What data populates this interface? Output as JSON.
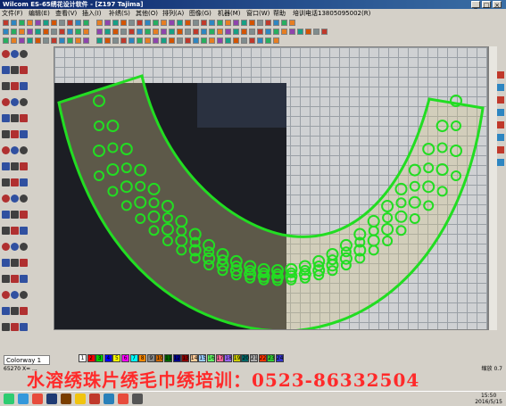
{
  "window": {
    "title": "Wilcom ES-65绣花设计软件 - [Z197 Tajima]",
    "subtitle": "Tajima"
  },
  "menu": [
    "文件(F)",
    "编辑(E)",
    "查看(V)",
    "插入(I)",
    "补绣(S)",
    "其他(O)",
    "排列(A)",
    "图像(G)",
    "机器(M)",
    "窗口(W)",
    "帮助",
    "培训电话13805095002(R)"
  ],
  "colors": {
    "accent": "#0a246a",
    "stitch_green": "#22dd22",
    "watermark": "#ff2a2a"
  },
  "combo": {
    "value": "Colorway 1"
  },
  "palette": [
    "1",
    "2",
    "3",
    "4",
    "5",
    "6",
    "7",
    "8",
    "9",
    "10",
    "11",
    "12",
    "13",
    "14",
    "15",
    "16",
    "17",
    "18",
    "19",
    "20",
    "21",
    "22",
    "23",
    "24"
  ],
  "status": {
    "left": "65270 X= ...",
    "right": "缩放 0.7"
  },
  "watermark": "水溶绣珠片绣毛巾绣培训：0523-86332504",
  "clock": {
    "time": "15:50",
    "date": "2016/5/15"
  },
  "taskbar_icons": [
    "start-icon",
    "browser-icon",
    "media-icon",
    "photoshop-icon",
    "illustrator-icon",
    "folder-icon",
    "pdf-icon",
    "document-icon",
    "wilcom-icon",
    "app-icon"
  ]
}
